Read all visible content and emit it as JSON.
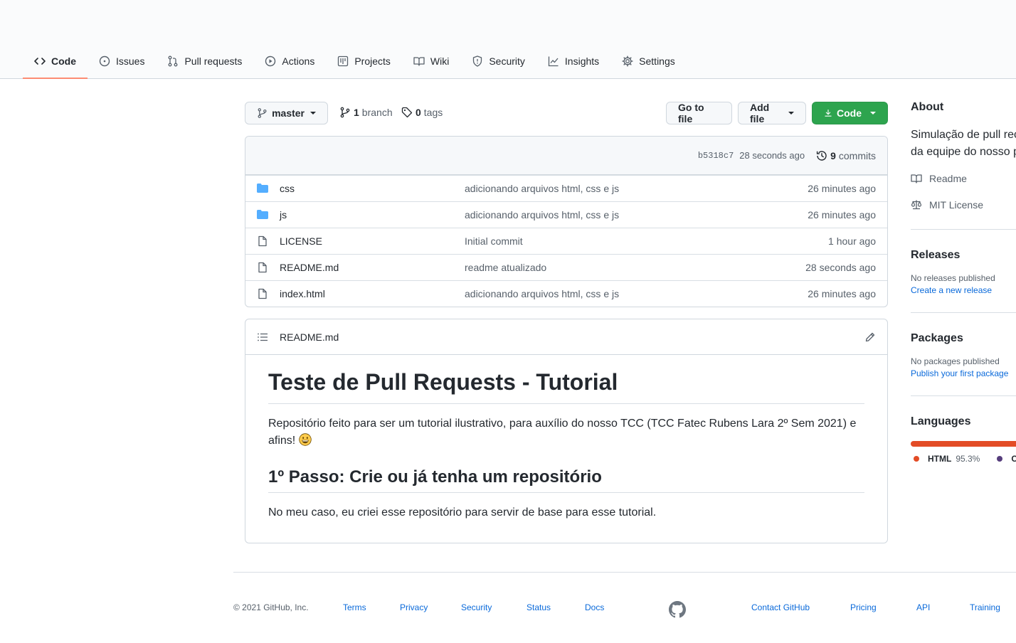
{
  "repo_nav": {
    "tabs": [
      {
        "label": "Code",
        "icon": "code-icon",
        "selected": true
      },
      {
        "label": "Issues",
        "icon": "issue-icon"
      },
      {
        "label": "Pull requests",
        "icon": "pull-request-icon"
      },
      {
        "label": "Actions",
        "icon": "play-icon"
      },
      {
        "label": "Projects",
        "icon": "project-icon"
      },
      {
        "label": "Wiki",
        "icon": "book-icon"
      },
      {
        "label": "Security",
        "icon": "shield-icon"
      },
      {
        "label": "Insights",
        "icon": "graph-icon"
      },
      {
        "label": "Settings",
        "icon": "gear-icon"
      }
    ]
  },
  "toolbar": {
    "branch_select": "master",
    "branch_count": "1",
    "branch_label": "branch",
    "tag_count": "0",
    "tag_label": "tags",
    "go_to_file": "Go to file",
    "add_file": "Add file",
    "code": "Code"
  },
  "latest_commit": {
    "sha": "b5318c7",
    "age": "28 seconds ago",
    "commit_count": "9",
    "commit_label": "commits"
  },
  "files": [
    {
      "name": "css",
      "type": "folder",
      "message": "adicionando arquivos html, css e js",
      "age": "26 minutes ago"
    },
    {
      "name": "js",
      "type": "folder",
      "message": "adicionando arquivos html, css e js",
      "age": "26 minutes ago"
    },
    {
      "name": "LICENSE",
      "type": "file",
      "message": "Initial commit",
      "age": "1 hour ago"
    },
    {
      "name": "README.md",
      "type": "file",
      "message": "readme atualizado",
      "age": "28 seconds ago"
    },
    {
      "name": "index.html",
      "type": "file",
      "message": "adicionando arquivos html, css e js",
      "age": "26 minutes ago"
    }
  ],
  "readme": {
    "filename": "README.md",
    "h1": "Teste de Pull Requests - Tutorial",
    "p1": "Repositório feito para ser um tutorial ilustrativo, para auxílio do nosso TCC (TCC Fatec Rubens Lara 2º Sem 2021) e afins!",
    "h2": "1º Passo: Crie ou já tenha um repositório",
    "p2": "No meu caso, eu criei esse repositório para servir de base para esse tutorial."
  },
  "sidebar": {
    "about_title": "About",
    "description_line1": "Simulação de pull rec",
    "description_line2": "da equipe do nosso p",
    "readme_link": "Readme",
    "license_link": "MIT License",
    "releases_title": "Releases",
    "releases_none": "No releases published",
    "releases_create": "Create a new release",
    "packages_title": "Packages",
    "packages_none": "No packages published",
    "packages_publish": "Publish your first package",
    "languages_title": "Languages",
    "languages": [
      {
        "name": "HTML",
        "percent": "95.3%",
        "color": "#e34c26",
        "share": 95.3
      },
      {
        "name": "CS",
        "percent": "",
        "color": "#563d7c",
        "share": 4.7
      }
    ]
  },
  "footer": {
    "copyright": "© 2021 GitHub, Inc.",
    "links": [
      "Terms",
      "Privacy",
      "Security",
      "Status",
      "Docs",
      "Contact GitHub",
      "Pricing",
      "API",
      "Training"
    ]
  },
  "colors": {
    "accent_tab": "#fd8c73",
    "green_button": "#2da44e",
    "folder": "#54aeff",
    "link": "#0969da"
  }
}
